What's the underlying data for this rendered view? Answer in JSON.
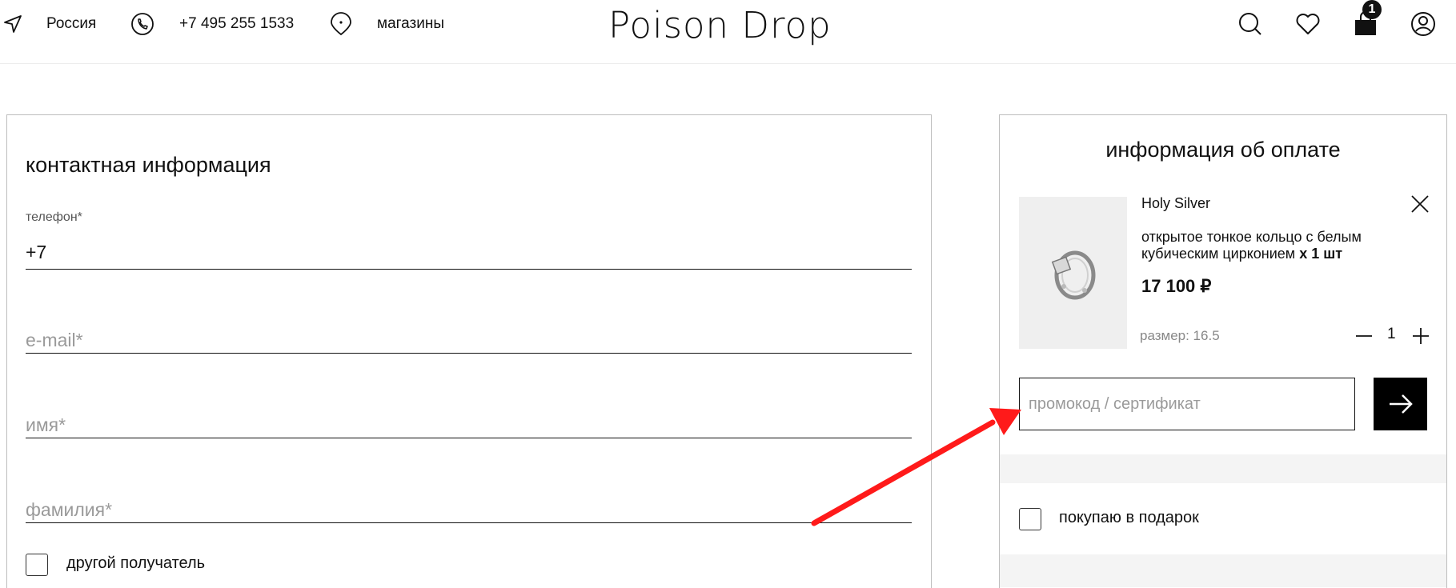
{
  "header": {
    "region": "Россия",
    "phone": "+7 495 255 1533",
    "stores": "магазины",
    "logo": "Poison Drop",
    "cart_count": "1"
  },
  "contact": {
    "title": "контактная информация",
    "phone_label": "телефон*",
    "phone_value": "+7",
    "email_placeholder": "e-mail*",
    "name_placeholder": "имя*",
    "surname_placeholder": "фамилия*",
    "other_recipient": "другой получатель"
  },
  "payment": {
    "title": "информация об оплате",
    "product": {
      "brand": "Holy Silver",
      "description": "открытое тонкое кольцо с белым кубическим цирконием",
      "quantity_text": "x 1 шт",
      "price": "17 100 ₽",
      "size": "размер: 16.5",
      "quantity": "1"
    },
    "promo_placeholder": "промокод / сертификат",
    "gift_label": "покупаю в подарок"
  },
  "colors": {
    "annotation_arrow": "#ff1a1a",
    "primary_button": "#000000"
  },
  "icons": {
    "location": "location-arrow-icon",
    "phone": "phone-icon",
    "stores": "map-pin-icon",
    "search": "search-icon",
    "favorites": "heart-icon",
    "cart": "shopping-bag-icon",
    "account": "user-icon"
  }
}
